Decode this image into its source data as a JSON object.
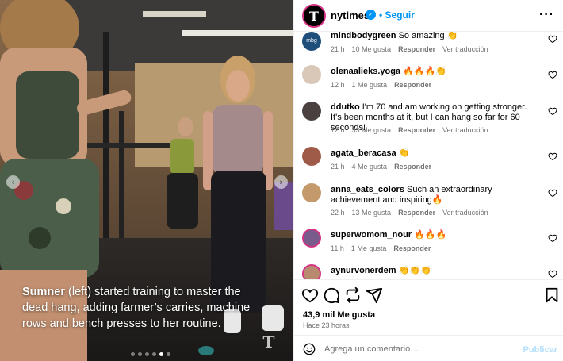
{
  "post": {
    "caption_name": "Sumner",
    "caption_text": " (left) started training to master the dead hang, adding farmer’s carries, machine rows and bench presses to her routine.",
    "watermark": "T",
    "slide_count": 6,
    "active_slide": 5
  },
  "header": {
    "avatar_letter": "T",
    "username": "nytimes",
    "verified_icon": "verified-badge-icon",
    "follow_label": "Seguir",
    "more_icon": "more-options-icon"
  },
  "comments": [
    {
      "user": "mindbodygreen",
      "text": "So amazing 👏",
      "time": "21 h",
      "likes": "10 Me gusta",
      "reply": "Responder",
      "translate": "Ver traducción",
      "avatar_color": "#1f4e7a",
      "avatar_text": "mbg"
    },
    {
      "user": "olenaalieks.yoga",
      "text": "🔥🔥🔥👏",
      "time": "12 h",
      "likes": "1 Me gusta",
      "reply": "Responder",
      "translate": "",
      "avatar_color": "#d9c7b8",
      "avatar_text": ""
    },
    {
      "user": "ddutko",
      "text": "I'm 70 and am working on getting stronger. It's been months at it, but I can hang so far for 60 seconds!",
      "time": "12 h",
      "likes": "33 Me gusta",
      "reply": "Responder",
      "translate": "Ver traducción",
      "avatar_color": "#4a4040",
      "avatar_text": ""
    },
    {
      "user": "agata_beracasa",
      "text": "👏",
      "time": "21 h",
      "likes": "4 Me gusta",
      "reply": "Responder",
      "translate": "",
      "avatar_color": "#a05a48",
      "avatar_text": ""
    },
    {
      "user": "anna_eats_colors",
      "text": "Such an extraordinary achievement and inspiring🔥",
      "time": "22 h",
      "likes": "13 Me gusta",
      "reply": "Responder",
      "translate": "Ver traducción",
      "avatar_color": "#c49a6c",
      "avatar_text": ""
    },
    {
      "user": "superwomom_nour",
      "text": "🔥🔥🔥",
      "time": "11 h",
      "likes": "1 Me gusta",
      "reply": "Responder",
      "translate": "",
      "avatar_color": "#7a5c8c",
      "avatar_text": ""
    },
    {
      "user": "aynurvonerdem",
      "text": "👏👏👏",
      "time": "",
      "likes": "",
      "reply": "",
      "translate": "",
      "avatar_color": "#b88a70",
      "avatar_text": ""
    }
  ],
  "actions": {
    "like_icon": "heart-icon",
    "comment_icon": "comment-icon",
    "share_icon": "repost-icon",
    "send_icon": "send-icon",
    "save_icon": "bookmark-icon",
    "likes_count": "43,9 mil Me gusta",
    "posted": "Hace 23 horas"
  },
  "composer": {
    "emoji_icon": "emoji-icon",
    "placeholder": "Agrega un comentario…",
    "value": "",
    "publish_label": "Publicar"
  },
  "colors": {
    "accent": "#0095f6",
    "publish_disabled": "#b2dffc",
    "muted": "#737373"
  }
}
